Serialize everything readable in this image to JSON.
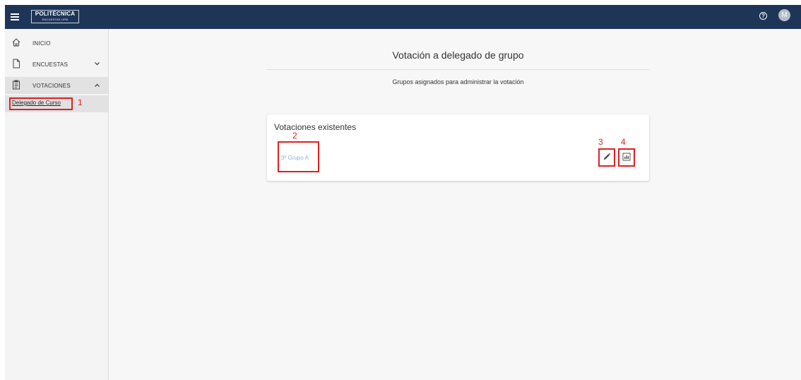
{
  "header": {
    "logo_main": "POLITÉCNICA",
    "logo_sub": "ENCUESTAS UPM",
    "help_glyph": "?",
    "avatar_initial": "M"
  },
  "sidebar": {
    "items": [
      {
        "label": "INICIO",
        "icon": "home-icon"
      },
      {
        "label": "ENCUESTAS",
        "icon": "document-icon",
        "chevron": "⌄"
      },
      {
        "label": "VOTACIONES",
        "icon": "clipboard-icon",
        "chevron": "^"
      }
    ],
    "sub_item_label": "Delegado de Curso"
  },
  "main": {
    "title": "Votación a delegado de grupo",
    "subtitle": "Grupos asignados para administrar la votación",
    "card": {
      "title": "Votaciones existentes",
      "group_link": "3º Grupo A"
    }
  },
  "annotations": [
    "1",
    "2",
    "3",
    "4"
  ],
  "colors": {
    "header_bg": "#1d3557",
    "annotation_red": "#e02020",
    "link_blue": "#8fb2d8"
  }
}
